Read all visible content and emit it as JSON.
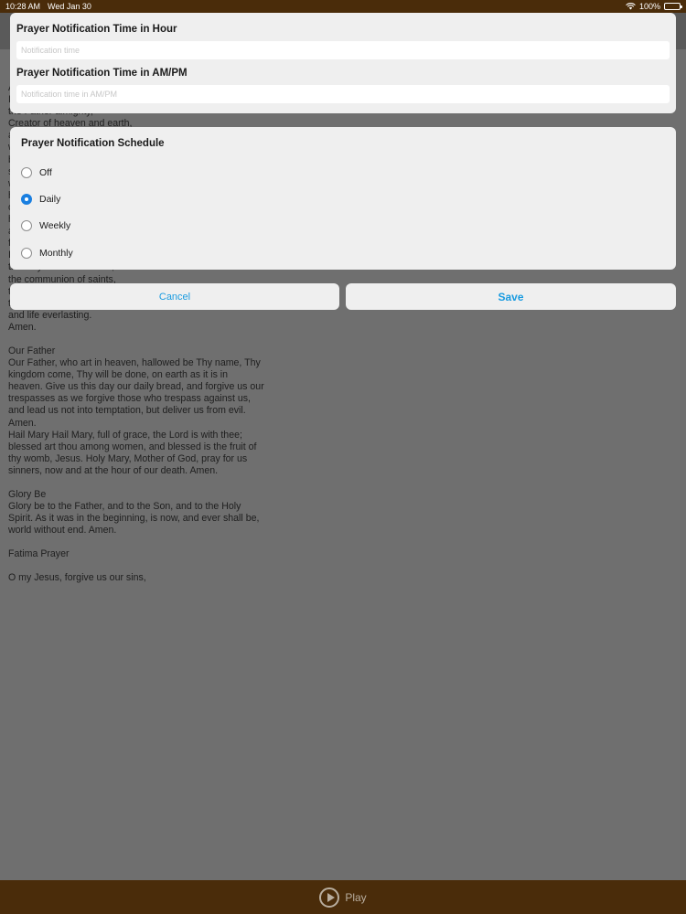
{
  "status_bar": {
    "time": "10:28 AM",
    "date": "Wed Jan 30",
    "battery": "100%"
  },
  "notification_form": {
    "hour_label": "Prayer Notification Time in Hour",
    "hour_placeholder": "Notification time",
    "ampm_label": "Prayer Notification Time in AM/PM",
    "ampm_placeholder": "Notification time in AM/PM"
  },
  "schedule": {
    "title": "Prayer Notification Schedule",
    "selected": "Daily",
    "options": [
      "Off",
      "Daily",
      "Weekly",
      "Monthly"
    ]
  },
  "actions": {
    "cancel": "Cancel",
    "save": "Save"
  },
  "prayers": [
    "Apostles' Creed\nI believe in God,\nthe Father almighty,\nCreator of heaven and earth,\nand in Jesus Christ, his only Son, our Lord,\nwho was conceived by the Holy Spirit,\nborn of the Virgin Mary,\nsuffered under Pontius Pilate,\nwas crucified, died and was buried;\nhe descended into hell;\non the third day he rose again from the dead;\nhe ascended into heaven,\nand is seated at the right hand of God the Father almighty;\nfrom there he will come to judge the living and the dead.\nI believe in the Holy Spirit,\nthe holy catholic Church,\nthe communion of saints,\nthe forgiveness of sins,\nthe resurrection of the body,\nand life everlasting.\nAmen.",
    "Our Father\nOur Father, who art in heaven, hallowed be Thy name, Thy kingdom come, Thy will be done, on earth as it is in heaven. Give us this day our daily bread, and forgive us our trespasses as we forgive those who trespass against us, and lead us not into temptation, but deliver us from evil. Amen.\nHail Mary Hail Mary, full of grace, the Lord is with thee; blessed art thou among women, and blessed is the fruit of thy womb, Jesus. Holy Mary, Mother of God, pray for us sinners, now and at the hour of our death. Amen.",
    "Glory Be\nGlory be to the Father, and to the Son, and to the Holy Spirit. As it was in the beginning, is now, and ever shall be, world without end. Amen.",
    "Fatima Prayer",
    "O my Jesus, forgive us our sins,"
  ],
  "player": {
    "play_label": "Play"
  }
}
